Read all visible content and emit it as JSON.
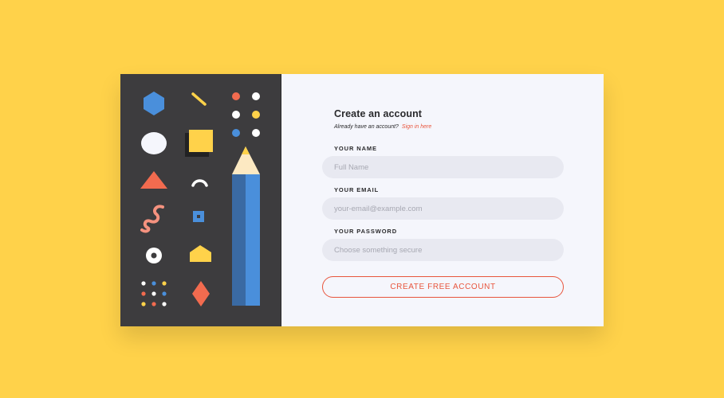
{
  "colors": {
    "background": "#FFD24A",
    "art_panel": "#3D3C3E",
    "form_panel": "#F5F6FC",
    "accent": "#E8553D",
    "blue": "#4A8FDB",
    "yellow": "#FFD24A",
    "coral": "#F26B4F"
  },
  "form": {
    "title": "Create an account",
    "signin_prompt": "Already have an account?",
    "signin_link": "Sign in here",
    "name_label": "YOUR NAME",
    "name_placeholder": "Full Name",
    "email_label": "YOUR EMAIL",
    "email_placeholder": "your-email@example.com",
    "password_label": "YOUR PASSWORD",
    "password_placeholder": "Choose something secure",
    "submit_label": "CREATE FREE ACCOUNT"
  },
  "illustration": {
    "shapes": [
      "hexagon-icon",
      "line-icon",
      "dots-grid-icon",
      "circle-icon",
      "square-icon",
      "triangle-icon",
      "arc-icon",
      "squiggle-icon",
      "target-square-icon",
      "donut-icon",
      "pentagon-icon",
      "confetti-dots-icon",
      "diamond-icon",
      "pencil-icon"
    ]
  }
}
